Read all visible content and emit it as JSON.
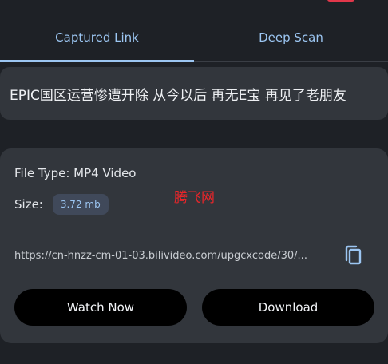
{
  "tabs": [
    {
      "label": "Captured Link",
      "active": true
    },
    {
      "label": "Deep Scan",
      "active": false
    }
  ],
  "video": {
    "title": "EPIC国区运营惨遭开除 从今以后 再无E宝 再见了老朋友",
    "file_type": "File Type: MP4 Video",
    "size_label": "Size:",
    "size_value": "3.72 mb",
    "url": "https://cn-hnzz-cm-01-03.bilivideo.com/upgcxcode/30/..."
  },
  "watermark": "腾飞网",
  "actions": {
    "watch_label": "Watch Now",
    "download_label": "Download"
  },
  "icons": {
    "copy": "copy-icon"
  },
  "colors": {
    "background": "#1e2126",
    "card": "#32363c",
    "accent": "#9cc6f2",
    "button": "#000000",
    "watermark": "#e8262a",
    "badge": "#e2374a"
  }
}
